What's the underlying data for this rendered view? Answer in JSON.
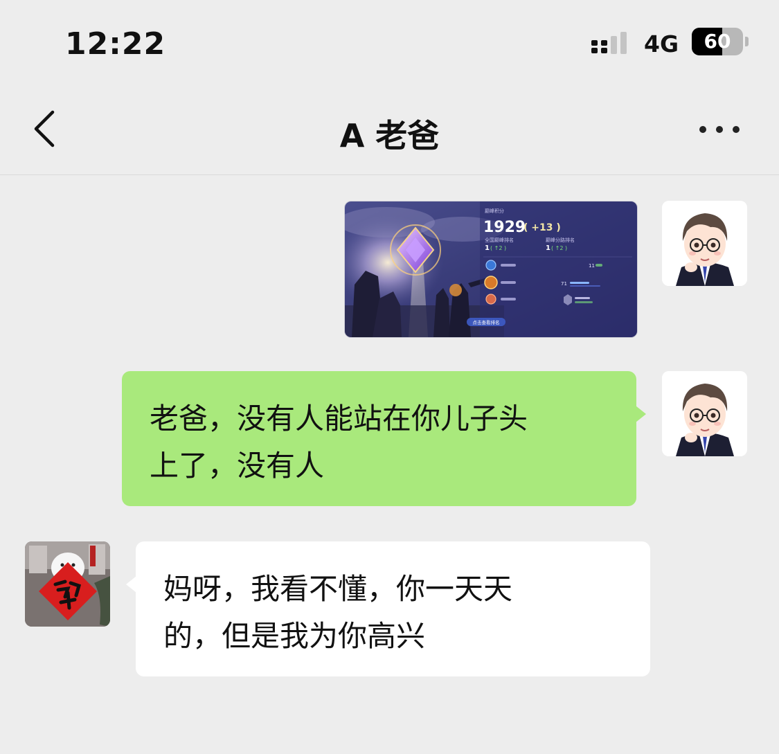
{
  "status_bar": {
    "time": "12:22",
    "network": "4G",
    "battery": "60",
    "battery_level": 0.6
  },
  "header": {
    "back_icon": "chevron-left-icon",
    "title": "A 老爸",
    "more_icon": "more-dots-icon"
  },
  "messages": [
    {
      "sender": "me",
      "type": "image",
      "game": {
        "score": "1929",
        "delta": "( +13 )",
        "rank_a": "1",
        "rank_a_delta": "( ↑2 )",
        "rank_b": "1",
        "rank_b_delta": "( ↑2 )",
        "stat_1": "11",
        "stat_2": "71",
        "button": "点击查看排名"
      }
    },
    {
      "sender": "me",
      "type": "text",
      "lines": [
        "老爸，没有人能站在你儿子头",
        "上了，没有人"
      ]
    },
    {
      "sender": "dad",
      "type": "text",
      "lines": [
        "妈呀，我看不懂，你一天天",
        "的，但是我为你高兴"
      ]
    }
  ],
  "colors": {
    "background": "#ededed",
    "my_bubble": "#a9e97c",
    "their_bubble": "#ffffff",
    "text": "#111111"
  }
}
